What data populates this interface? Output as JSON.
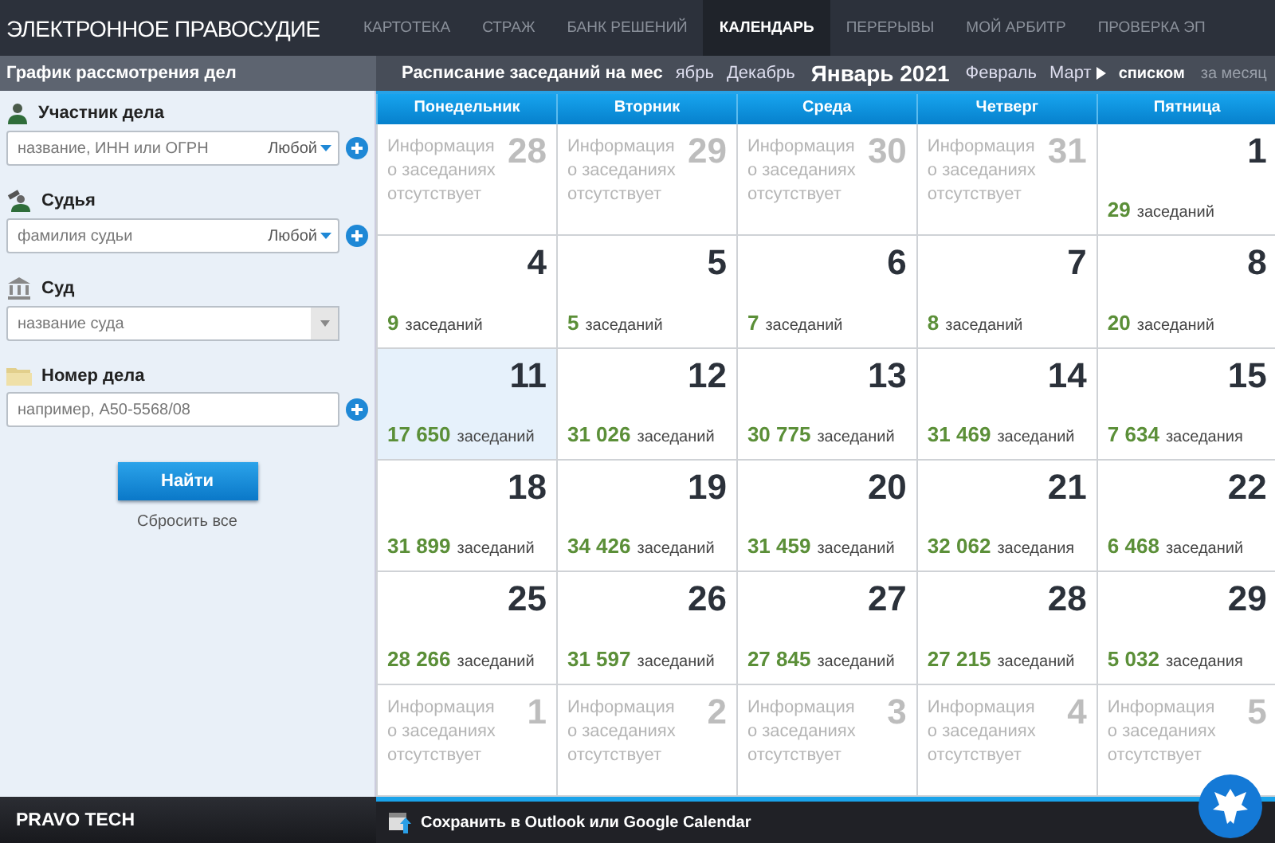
{
  "header": {
    "title": "ЭЛЕКТРОННОЕ ПРАВОСУДИЕ",
    "nav": [
      {
        "label": "КАРТОТЕКА",
        "selected": false
      },
      {
        "label": "СТРАЖ",
        "selected": false
      },
      {
        "label": "БАНК РЕШЕНИЙ",
        "selected": false
      },
      {
        "label": "КАЛЕНДАРЬ",
        "selected": true
      },
      {
        "label": "ПЕРЕРЫВЫ",
        "selected": false
      },
      {
        "label": "МОЙ АРБИТР",
        "selected": false
      },
      {
        "label": "ПРОВЕРКА ЭП",
        "selected": false
      }
    ]
  },
  "subheader": {
    "left_title": "График рассмотрения дел",
    "schedule_label": "Расписание заседаний на мес",
    "months": [
      {
        "label": "ябрь",
        "selected": false
      },
      {
        "label": "Декабрь",
        "selected": false
      },
      {
        "label": "Январь 2021",
        "selected": true
      },
      {
        "label": "Февраль",
        "selected": false
      },
      {
        "label": "Март",
        "selected": false
      }
    ],
    "views": [
      {
        "label": "списком",
        "selected": true
      },
      {
        "label": "за месяц",
        "selected": false
      }
    ]
  },
  "filters": [
    {
      "kind": "any",
      "label": "Участник дела",
      "placeholder": "название, ИНН или ОГРН",
      "option": "Любой"
    },
    {
      "kind": "any",
      "label": "Судья",
      "placeholder": "фамилия судьи",
      "option": "Любой"
    },
    {
      "kind": "select",
      "label": "Суд",
      "placeholder": "название суда"
    },
    {
      "kind": "text",
      "label": "Номер дела",
      "placeholder": "например, А50-5568/08"
    }
  ],
  "search_button": "Найти",
  "reset_link": "Сбросить все",
  "calendar": {
    "weekdays": [
      "Понедельник",
      "Вторник",
      "Среда",
      "Четверг",
      "Пятница"
    ],
    "weeks": [
      [
        {
          "day": "28",
          "kind": "no_info",
          "info": "Информация о заседаниях отсутствует",
          "selected": false
        },
        {
          "day": "29",
          "kind": "no_info",
          "info": "Информация о заседаниях отсутствует",
          "selected": false
        },
        {
          "day": "30",
          "kind": "no_info",
          "info": "Информация о заседаниях отсутствует",
          "selected": false
        },
        {
          "day": "31",
          "kind": "no_info",
          "info": "Информация о заседаниях отсутствует",
          "selected": false
        },
        {
          "day": "1",
          "kind": "sessions",
          "count": "29",
          "unit": "заседаний",
          "selected": false
        }
      ],
      [
        {
          "day": "4",
          "kind": "sessions",
          "count": "9",
          "unit": "заседаний",
          "selected": false
        },
        {
          "day": "5",
          "kind": "sessions",
          "count": "5",
          "unit": "заседаний",
          "selected": false
        },
        {
          "day": "6",
          "kind": "sessions",
          "count": "7",
          "unit": "заседаний",
          "selected": false
        },
        {
          "day": "7",
          "kind": "sessions",
          "count": "8",
          "unit": "заседаний",
          "selected": false
        },
        {
          "day": "8",
          "kind": "sessions",
          "count": "20",
          "unit": "заседаний",
          "selected": false
        }
      ],
      [
        {
          "day": "11",
          "kind": "sessions",
          "count": "17 650",
          "unit": "заседаний",
          "selected": true
        },
        {
          "day": "12",
          "kind": "sessions",
          "count": "31 026",
          "unit": "заседаний",
          "selected": false
        },
        {
          "day": "13",
          "kind": "sessions",
          "count": "30 775",
          "unit": "заседаний",
          "selected": false
        },
        {
          "day": "14",
          "kind": "sessions",
          "count": "31 469",
          "unit": "заседаний",
          "selected": false
        },
        {
          "day": "15",
          "kind": "sessions",
          "count": "7 634",
          "unit": "заседания",
          "selected": false
        }
      ],
      [
        {
          "day": "18",
          "kind": "sessions",
          "count": "31 899",
          "unit": "заседаний",
          "selected": false
        },
        {
          "day": "19",
          "kind": "sessions",
          "count": "34 426",
          "unit": "заседаний",
          "selected": false
        },
        {
          "day": "20",
          "kind": "sessions",
          "count": "31 459",
          "unit": "заседаний",
          "selected": false
        },
        {
          "day": "21",
          "kind": "sessions",
          "count": "32 062",
          "unit": "заседания",
          "selected": false
        },
        {
          "day": "22",
          "kind": "sessions",
          "count": "6 468",
          "unit": "заседаний",
          "selected": false
        }
      ],
      [
        {
          "day": "25",
          "kind": "sessions",
          "count": "28 266",
          "unit": "заседаний",
          "selected": false
        },
        {
          "day": "26",
          "kind": "sessions",
          "count": "31 597",
          "unit": "заседаний",
          "selected": false
        },
        {
          "day": "27",
          "kind": "sessions",
          "count": "27 845",
          "unit": "заседаний",
          "selected": false
        },
        {
          "day": "28",
          "kind": "sessions",
          "count": "27 215",
          "unit": "заседаний",
          "selected": false
        },
        {
          "day": "29",
          "kind": "sessions",
          "count": "5 032",
          "unit": "заседания",
          "selected": false
        }
      ],
      [
        {
          "day": "1",
          "kind": "no_info",
          "info": "Информация о заседаниях отсутствует",
          "selected": false
        },
        {
          "day": "2",
          "kind": "no_info",
          "info": "Информация о заседаниях отсутствует",
          "selected": false
        },
        {
          "day": "3",
          "kind": "no_info",
          "info": "Информация о заседаниях отсутствует",
          "selected": false
        },
        {
          "day": "4",
          "kind": "no_info",
          "info": "Информация о заседаниях отсутствует",
          "selected": false
        },
        {
          "day": "5",
          "kind": "no_info",
          "info": "Информация о заседаниях отсутствует",
          "selected": false
        }
      ]
    ]
  },
  "footer": {
    "brand": "PRAVO TECH",
    "export_link": "Сохранить в Outlook или Google Calendar"
  }
}
